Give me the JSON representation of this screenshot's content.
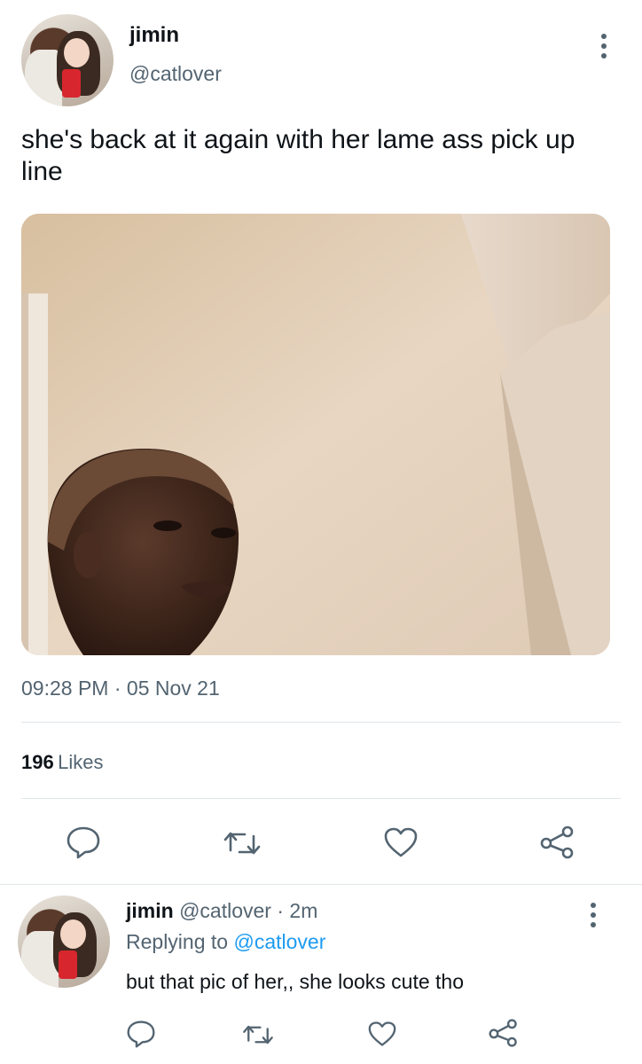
{
  "main_tweet": {
    "author_name": "jimin",
    "author_handle": "@catlover",
    "text": "she's back at it again with her lame ass pick up line",
    "time": "09:28 PM",
    "separator": "·",
    "date": "05 Nov 21",
    "likes_count": "196",
    "likes_label": "Likes"
  },
  "reply": {
    "author_name": "jimin",
    "author_handle": "@catlover",
    "separator": "·",
    "age": "2m",
    "replying_prefix": "Replying to",
    "replying_handle": "@catlover",
    "text": "but that pic of her,, she looks cute tho"
  },
  "icons": [
    "more-icon",
    "reply-icon",
    "retweet-icon",
    "like-icon",
    "share-icon"
  ],
  "colors": {
    "link": "#1d9bf0",
    "secondary_text": "#536471",
    "icon": "#536471",
    "divider": "#e1e6ea"
  }
}
